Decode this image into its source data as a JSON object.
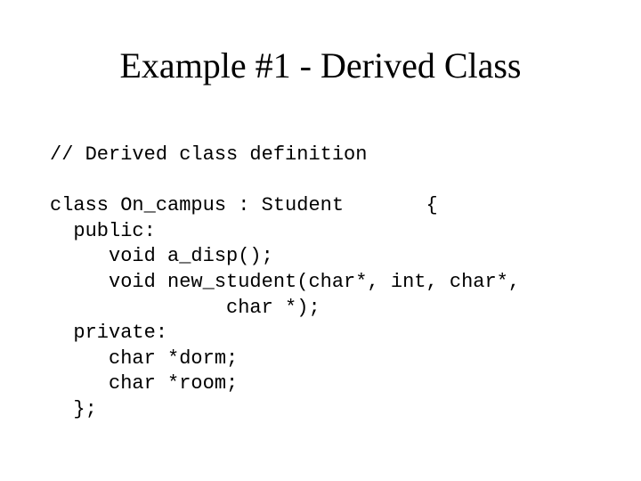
{
  "title": "Example #1 - Derived Class",
  "code": {
    "l1": "// Derived class definition",
    "l2": "",
    "l3": "class On_campus : Student       {",
    "l4": "  public:",
    "l5": "     void a_disp();",
    "l6": "     void new_student(char*, int, char*,",
    "l7": "               char *);",
    "l8": "  private:",
    "l9": "     char *dorm;",
    "l10": "     char *room;",
    "l11": "  };"
  }
}
